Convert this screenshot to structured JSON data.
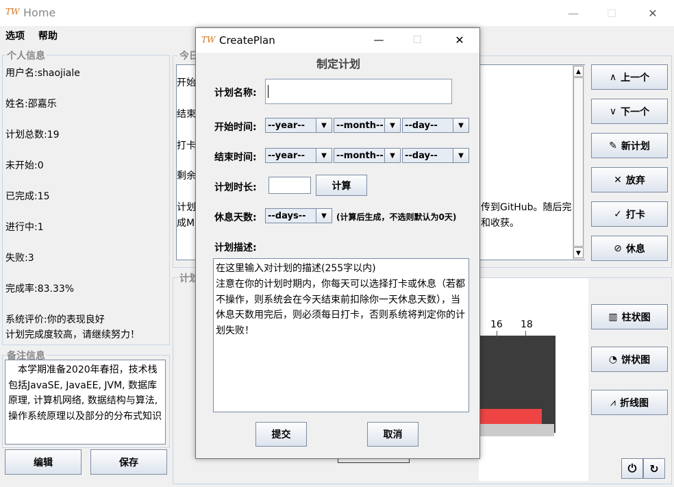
{
  "window": {
    "logo": "TW",
    "title": "Home",
    "minimize": "—",
    "maximize": "☐",
    "close": "✕"
  },
  "menu": [
    "选项",
    "帮助"
  ],
  "personal": {
    "title": "个人信息",
    "lines": [
      "用户名:shaojiale",
      "姓名:邵嘉乐",
      "计划总数:19",
      "未开始:0",
      "已完成:15",
      "进行中:1",
      "失败:3",
      "完成率:83.33%",
      "系统评价:你的表现良好",
      "计划完成度较高，请继续努力！"
    ]
  },
  "notes": {
    "title": "备注信息",
    "text": "本学期准备2020年春招，技术栈包括JavaSE, JavaEE, JVM, 数据库原理, 计算机网络, 数据结构与算法, 操作系统原理以及部分的分布式知识"
  },
  "bottom_buttons": {
    "edit": "编辑",
    "save": "保存"
  },
  "today": {
    "title": "今日",
    "rows": [
      "开始",
      "结束",
      "打卡",
      "剩余",
      "计划"
    ],
    "text_right_1": "传到GitHub。随后完",
    "text_left_2": "成M",
    "text_right_2": "和收获。"
  },
  "chart_group": {
    "title": "计划",
    "ticks": [
      "16",
      "18"
    ]
  },
  "side_buttons": [
    {
      "icon": "∧",
      "label": "上一个"
    },
    {
      "icon": "∨",
      "label": "下一个"
    },
    {
      "icon": "✎",
      "label": "新计划"
    },
    {
      "icon": "✕",
      "label": "放弃"
    },
    {
      "icon": "✓",
      "label": "打卡"
    },
    {
      "icon": "⊘",
      "label": "休息"
    }
  ],
  "chart_buttons": [
    {
      "icon": "▥",
      "label": "柱状图"
    },
    {
      "icon": "◔",
      "label": "饼状图"
    },
    {
      "icon": "⩘",
      "label": "折线图"
    }
  ],
  "corner_buttons": {
    "power": "⏻",
    "refresh": "↻"
  },
  "dialog": {
    "logo": "TW",
    "title": "CreatePlan",
    "minimize": "—",
    "maximize": "☐",
    "close": "✕",
    "heading": "制定计划",
    "name_label": "计划名称:",
    "name_value": "",
    "start_label": "开始时间:",
    "end_label": "结束时间:",
    "year": "--year--",
    "month": "--month--",
    "day": "--day--",
    "duration_label": "计划时长:",
    "calc_button": "计算",
    "rest_label": "休息天数:",
    "days": "--days--",
    "rest_hint": "(计算后生成，不选则默认为0天)",
    "desc_label": "计划描述:",
    "desc_text": "在这里输入对计划的描述(255字以内)\n注意在你的计划时期内，你每天可以选择打卡或休息（若都不操作，则系统会在今天结束前扣除你一天休息天数），当休息天数用完后，则必须每日打卡，否则系统将判定你的计划失败！",
    "submit": "提交",
    "cancel": "取消"
  }
}
